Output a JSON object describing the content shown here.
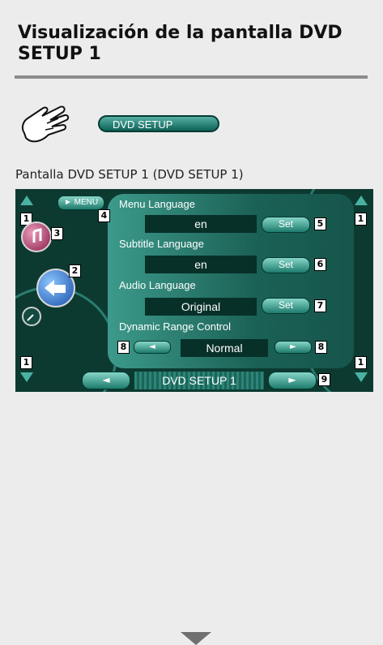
{
  "section_title": "Visualización de la pantalla DVD SETUP 1",
  "dvd_setup_button": "DVD SETUP",
  "caption": "Pantalla DVD SETUP 1 (DVD SETUP 1)",
  "screen": {
    "menu_button": "► MENU",
    "rows": [
      {
        "label": "Menu Language",
        "value": "en",
        "button": "Set",
        "callout": "5"
      },
      {
        "label": "Subtitle Language",
        "value": "en",
        "button": "Set",
        "callout": "6"
      },
      {
        "label": "Audio Language",
        "value": "Original",
        "button": "Set",
        "callout": "7"
      }
    ],
    "drc_label": "Dynamic Range Control",
    "drc_value": "Normal",
    "drc_left": "◄",
    "drc_right": "►",
    "bottom_title": "DVD SETUP 1",
    "nav_prev": "◄",
    "nav_next": "►",
    "callouts": {
      "c1": "1",
      "c2": "2",
      "c3": "3",
      "c4": "4",
      "c8": "8",
      "c9": "9"
    }
  },
  "icons": [
    "hand-pointer-icon",
    "music-note-icon",
    "back-arrow-icon",
    "wrench-icon",
    "scroll-up-icon",
    "scroll-down-icon",
    "page-down-arrow-icon"
  ]
}
